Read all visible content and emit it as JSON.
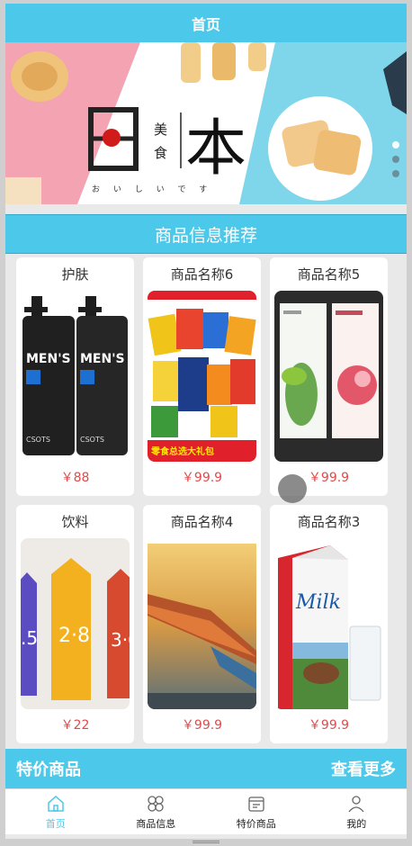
{
  "navbar": {
    "title": "首页"
  },
  "banner": {
    "big_char_left": "日",
    "big_char_right": "本",
    "small_chars": [
      "美",
      "食"
    ],
    "kana": "お い し い で す"
  },
  "section": {
    "title": "商品信息推荐"
  },
  "products": [
    {
      "name": "护肤",
      "price": "￥88"
    },
    {
      "name": "商品名称6",
      "price": "￥99.9"
    },
    {
      "name": "商品名称5",
      "price": "￥99.9"
    },
    {
      "name": "饮料",
      "price": "￥22"
    },
    {
      "name": "商品名称4",
      "price": "￥99.9"
    },
    {
      "name": "商品名称3",
      "price": "￥99.9"
    }
  ],
  "special": {
    "title": "特价商品",
    "more": "查看更多"
  },
  "tabbar": {
    "items": [
      {
        "label": "首页",
        "icon": "home-icon",
        "active": true
      },
      {
        "label": "商品信息",
        "icon": "grid-icon",
        "active": false
      },
      {
        "label": "特价商品",
        "icon": "calendar-icon",
        "active": false
      },
      {
        "label": "我的",
        "icon": "user-icon",
        "active": false
      }
    ]
  },
  "colors": {
    "primary": "#4cc8ea",
    "price": "#e24a4a"
  }
}
